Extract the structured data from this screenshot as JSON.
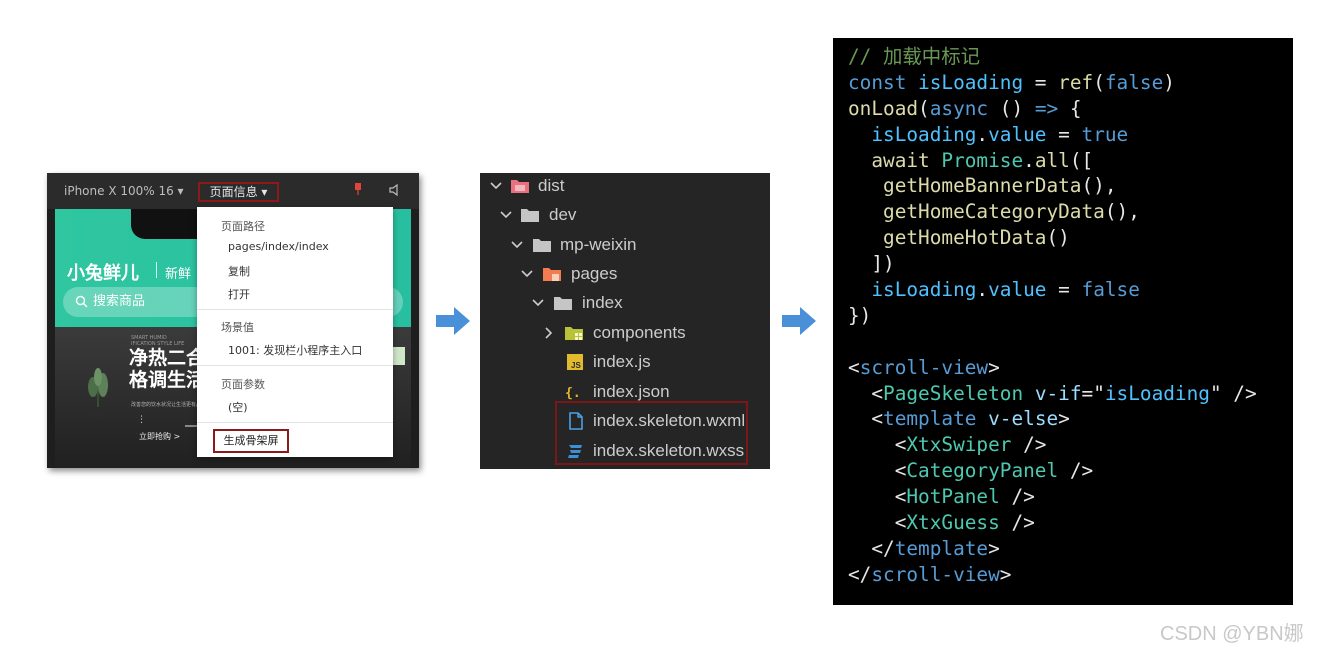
{
  "simulator": {
    "device_label": "iPhone X 100% 16 ▾",
    "page_info_label": "页面信息 ▾",
    "app": {
      "logo": "小兔鲜儿",
      "slogan": "新鲜",
      "search_placeholder": "搜索商品",
      "banner_small": "SMART HUMID\nIFICATION STYLE LIFE",
      "banner_title_line1": "净热二合",
      "banner_title_line2": "格调生活",
      "banner_desc": "改善您的饮水状况让生活更有品质",
      "banner_dots": "⋮",
      "banner_buy": "立即抢购 >"
    },
    "menu": {
      "path_header": "页面路径",
      "path_value": "pages/index/index",
      "copy": "复制",
      "open": "打开",
      "scene_header": "场景值",
      "scene_value": "1001: 发现栏小程序主入口",
      "params_header": "页面参数",
      "params_value": "(空)",
      "generate_skeleton": "生成骨架屏"
    }
  },
  "explorer": {
    "items": [
      {
        "label": "dist",
        "icon": "folder-special-icon"
      },
      {
        "label": "dev",
        "icon": "folder-icon"
      },
      {
        "label": "mp-weixin",
        "icon": "folder-icon"
      },
      {
        "label": "pages",
        "icon": "folder-pages-icon"
      },
      {
        "label": "index",
        "icon": "folder-icon"
      },
      {
        "label": "components",
        "icon": "folder-components-icon"
      },
      {
        "label": "index.js",
        "icon": "js-file-icon"
      },
      {
        "label": "index.json",
        "icon": "json-file-icon"
      },
      {
        "label": "index.skeleton.wxml",
        "icon": "wxml-file-icon"
      },
      {
        "label": "index.skeleton.wxss",
        "icon": "wxss-file-icon"
      }
    ]
  },
  "code_lines": [
    [
      {
        "t": "// 加载中标记",
        "c": "comment"
      }
    ],
    [
      {
        "t": "const ",
        "c": "kw"
      },
      {
        "t": "isLoading",
        "c": "var"
      },
      {
        "t": " = ",
        "c": "plain"
      },
      {
        "t": "ref",
        "c": "fn"
      },
      {
        "t": "(",
        "c": "plain"
      },
      {
        "t": "false",
        "c": "kw"
      },
      {
        "t": ")",
        "c": "plain"
      }
    ],
    [
      {
        "t": "onLoad",
        "c": "fn"
      },
      {
        "t": "(",
        "c": "plain"
      },
      {
        "t": "async",
        "c": "kw"
      },
      {
        "t": " () ",
        "c": "plain"
      },
      {
        "t": "=>",
        "c": "kw"
      },
      {
        "t": " {",
        "c": "plain"
      }
    ],
    [
      {
        "t": "  isLoading",
        "c": "var"
      },
      {
        "t": ".",
        "c": "plain"
      },
      {
        "t": "value",
        "c": "var"
      },
      {
        "t": " = ",
        "c": "plain"
      },
      {
        "t": "true",
        "c": "kw"
      }
    ],
    [
      {
        "t": "  await ",
        "c": "fn"
      },
      {
        "t": "Promise",
        "c": "cls"
      },
      {
        "t": ".",
        "c": "plain"
      },
      {
        "t": "all",
        "c": "fn"
      },
      {
        "t": "([",
        "c": "plain"
      }
    ],
    [
      {
        "t": "   getHomeBannerData",
        "c": "fn"
      },
      {
        "t": "(),",
        "c": "plain"
      }
    ],
    [
      {
        "t": "   getHomeCategoryData",
        "c": "fn"
      },
      {
        "t": "(),",
        "c": "plain"
      }
    ],
    [
      {
        "t": "   getHomeHotData",
        "c": "fn"
      },
      {
        "t": "()",
        "c": "plain"
      }
    ],
    [
      {
        "t": "  ])",
        "c": "plain"
      }
    ],
    [
      {
        "t": "  isLoading",
        "c": "var"
      },
      {
        "t": ".",
        "c": "plain"
      },
      {
        "t": "value",
        "c": "var"
      },
      {
        "t": " = ",
        "c": "plain"
      },
      {
        "t": "false",
        "c": "kw"
      }
    ],
    [
      {
        "t": "})",
        "c": "plain"
      }
    ],
    [
      {
        "t": "",
        "c": "plain"
      }
    ],
    [
      {
        "t": "<",
        "c": "plain"
      },
      {
        "t": "scroll-view",
        "c": "tag"
      },
      {
        "t": ">",
        "c": "plain"
      }
    ],
    [
      {
        "t": "  <",
        "c": "plain"
      },
      {
        "t": "PageSkeleton",
        "c": "cls"
      },
      {
        "t": " ",
        "c": "plain"
      },
      {
        "t": "v-if",
        "c": "attr"
      },
      {
        "t": "=\"",
        "c": "plain"
      },
      {
        "t": "isLoading",
        "c": "var"
      },
      {
        "t": "\" />",
        "c": "plain"
      }
    ],
    [
      {
        "t": "  <",
        "c": "plain"
      },
      {
        "t": "template",
        "c": "tag"
      },
      {
        "t": " ",
        "c": "plain"
      },
      {
        "t": "v-else",
        "c": "attr"
      },
      {
        "t": ">",
        "c": "plain"
      }
    ],
    [
      {
        "t": "    <",
        "c": "plain"
      },
      {
        "t": "XtxSwiper",
        "c": "cls"
      },
      {
        "t": " />",
        "c": "plain"
      }
    ],
    [
      {
        "t": "    <",
        "c": "plain"
      },
      {
        "t": "CategoryPanel",
        "c": "cls"
      },
      {
        "t": " />",
        "c": "plain"
      }
    ],
    [
      {
        "t": "    <",
        "c": "plain"
      },
      {
        "t": "HotPanel",
        "c": "cls"
      },
      {
        "t": " />",
        "c": "plain"
      }
    ],
    [
      {
        "t": "    <",
        "c": "plain"
      },
      {
        "t": "XtxGuess",
        "c": "cls"
      },
      {
        "t": " />",
        "c": "plain"
      }
    ],
    [
      {
        "t": "  </",
        "c": "plain"
      },
      {
        "t": "template",
        "c": "tag"
      },
      {
        "t": ">",
        "c": "plain"
      }
    ],
    [
      {
        "t": "</",
        "c": "plain"
      },
      {
        "t": "scroll-view",
        "c": "tag"
      },
      {
        "t": ">",
        "c": "plain"
      }
    ]
  ],
  "colors": {
    "comment": "#6a9955",
    "kw": "#569cd6",
    "var": "#4fc1ff",
    "fn": "#dcdcaa",
    "cls": "#4ec9b0",
    "tag": "#569cd6",
    "attr": "#9cdcfe",
    "plain": "#e6e6e6",
    "accent_red": "#8b1a1a",
    "arrow_blue": "#4a90d9"
  },
  "watermark": "CSDN @YBN娜"
}
